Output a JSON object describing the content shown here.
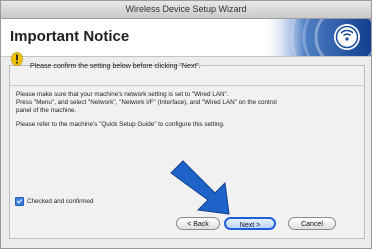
{
  "window": {
    "title": "Wireless Device Setup Wizard"
  },
  "banner": {
    "title": "Important Notice"
  },
  "notice": {
    "text": "Please confirm the setting below before clicking \"Next\"."
  },
  "body": {
    "lines": [
      "Please make sure that your machine's network setting is set to \"Wired LAN\".",
      "Press \"Menu\", and select \"Network\", \"Network I/F\" (Interface), and \"Wired LAN\" on the control",
      "panel of the machine.",
      "Please refer to the machine's \"Quick Setup Guide\" to configure this setting."
    ]
  },
  "checkbox": {
    "label": "Checked and confirmed",
    "checked": true
  },
  "buttons": {
    "back": "< Back",
    "next": "Next >",
    "cancel": "Cancel"
  },
  "colors": {
    "accent": "#1f5fd6",
    "arrow": "#1e63c8",
    "warning": "#f2c200"
  }
}
